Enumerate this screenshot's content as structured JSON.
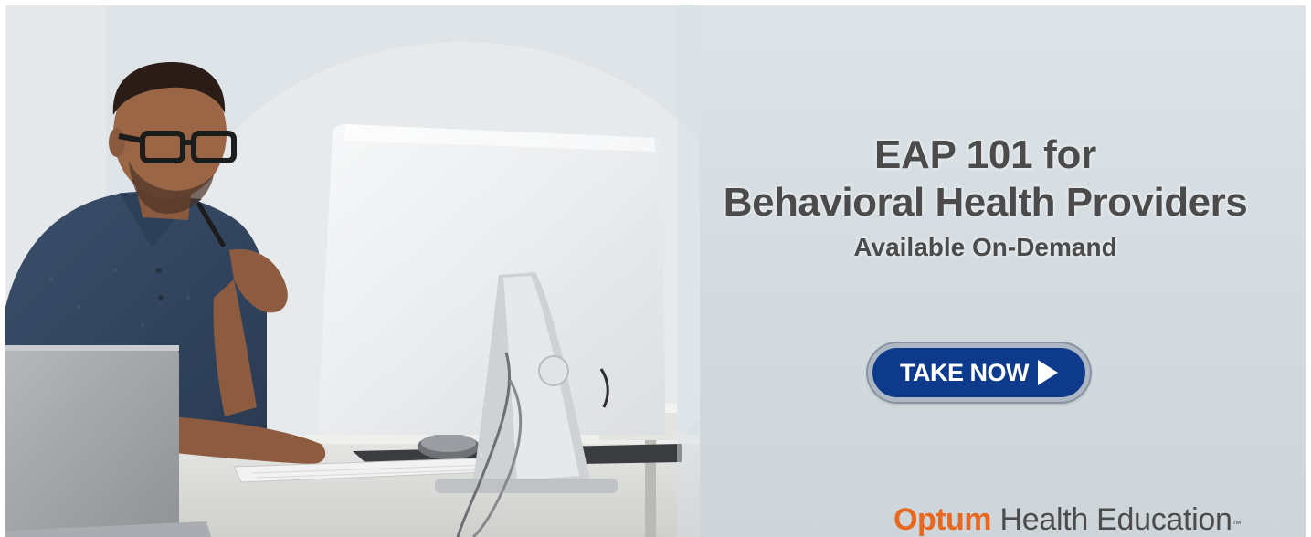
{
  "banner": {
    "title_line1": "EAP 101 for",
    "title_line2": "Behavioral Health Providers",
    "subtitle": "Available On-Demand",
    "cta_label": "TAKE NOW",
    "brand_name": "Optum",
    "brand_suffix": "Health Education",
    "brand_trademark": "™"
  },
  "colors": {
    "background": "#d8dfe4",
    "cta_fill": "#0e3a8c",
    "brand_orange": "#e8681f",
    "headline_text": "#4b4b4b"
  },
  "icons": {
    "cta_arrow": "play-triangle-icon"
  }
}
